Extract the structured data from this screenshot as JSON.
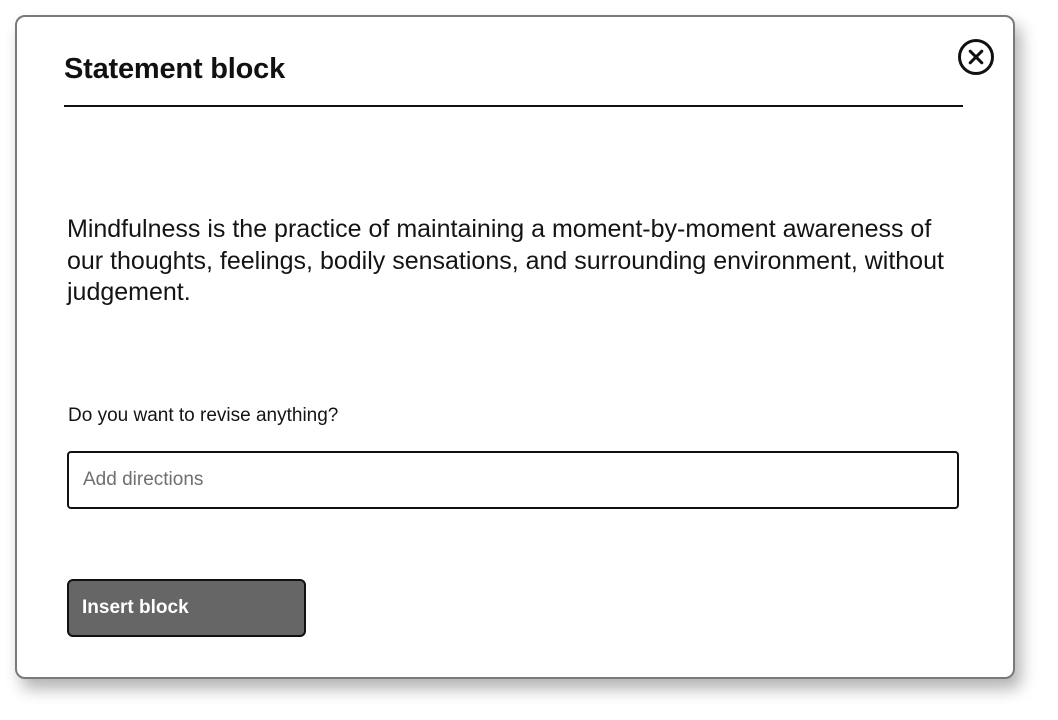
{
  "dialog": {
    "title": "Statement block",
    "close_icon": "close-circle-icon",
    "statement_text": "Mindfulness is the practice of maintaining a moment-by-moment awareness of our thoughts, feelings, bodily sensations, and surrounding environment, without judgement.",
    "revise_prompt": "Do you want to revise anything?",
    "directions_input": {
      "value": "",
      "placeholder": "Add directions"
    },
    "insert_button_label": "Insert block"
  },
  "colors": {
    "button_background": "#676667",
    "border": "#111111",
    "modal_border": "#7a7a7a",
    "placeholder": "#6f6f6f"
  }
}
